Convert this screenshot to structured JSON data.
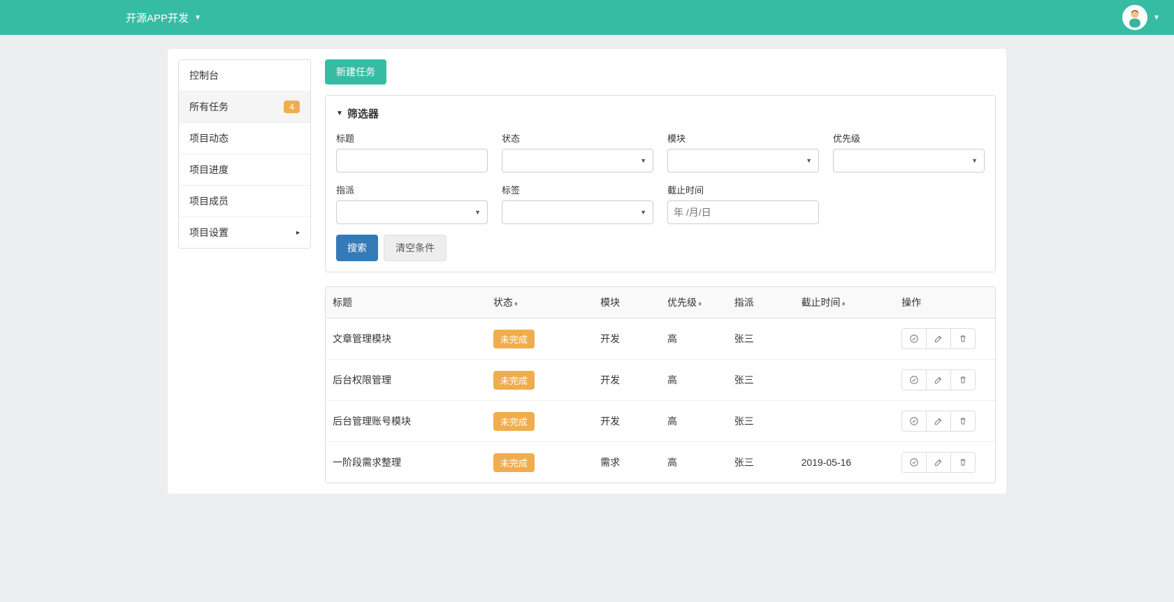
{
  "topbar": {
    "project_name": "开源APP开发"
  },
  "sidebar": {
    "items": [
      {
        "label": "控制台"
      },
      {
        "label": "所有任务",
        "badge": "4",
        "active": true
      },
      {
        "label": "项目动态"
      },
      {
        "label": "项目进度"
      },
      {
        "label": "项目成员"
      },
      {
        "label": "项目设置",
        "has_children": true
      }
    ]
  },
  "main": {
    "new_task_btn": "新建任务",
    "filter": {
      "title": "筛选器",
      "fields": {
        "title_label": "标题",
        "status_label": "状态",
        "module_label": "模块",
        "priority_label": "优先级",
        "assignee_label": "指派",
        "tag_label": "标签",
        "deadline_label": "截止时间",
        "deadline_placeholder": "年 /月/日"
      },
      "search_btn": "搜索",
      "reset_btn": "清空条件"
    },
    "table": {
      "headers": {
        "title": "标题",
        "status": "状态",
        "module": "模块",
        "priority": "优先级",
        "assignee": "指派",
        "deadline": "截止时间",
        "actions": "操作"
      },
      "rows": [
        {
          "title": "文章管理模块",
          "status": "未完成",
          "module": "开发",
          "priority": "高",
          "assignee": "张三",
          "deadline": ""
        },
        {
          "title": "后台权限管理",
          "status": "未完成",
          "module": "开发",
          "priority": "高",
          "assignee": "张三",
          "deadline": ""
        },
        {
          "title": "后台管理账号模块",
          "status": "未完成",
          "module": "开发",
          "priority": "高",
          "assignee": "张三",
          "deadline": ""
        },
        {
          "title": "一阶段需求整理",
          "status": "未完成",
          "module": "需求",
          "priority": "高",
          "assignee": "张三",
          "deadline": "2019-05-16"
        }
      ]
    }
  }
}
